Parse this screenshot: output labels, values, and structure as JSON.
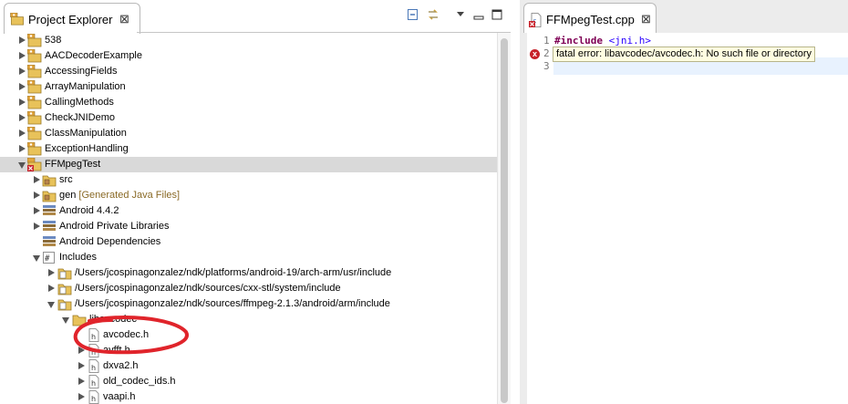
{
  "project_explorer": {
    "title": "Project Explorer",
    "close_glyph": "⊠",
    "toolbar": [
      "collapse-all-icon",
      "link-with-editor-icon",
      "view-menu-icon",
      "minimize-icon",
      "maximize-icon"
    ],
    "items": [
      {
        "label": "538"
      },
      {
        "label": "AACDecoderExample"
      },
      {
        "label": "AccessingFields"
      },
      {
        "label": "ArrayManipulation"
      },
      {
        "label": "CallingMethods"
      },
      {
        "label": "CheckJNIDemo"
      },
      {
        "label": "ClassManipulation"
      },
      {
        "label": "ExceptionHandling"
      },
      {
        "label": "FFMpegTest"
      },
      {
        "label": "src"
      },
      {
        "label": "gen",
        "decoration": "[Generated Java Files]"
      },
      {
        "label": "Android 4.4.2"
      },
      {
        "label": "Android Private Libraries"
      },
      {
        "label": "Android Dependencies"
      },
      {
        "label": "Includes"
      },
      {
        "label": "/Users/jcospinagonzalez/ndk/platforms/android-19/arch-arm/usr/include"
      },
      {
        "label": "/Users/jcospinagonzalez/ndk/sources/cxx-stl/system/include"
      },
      {
        "label": "/Users/jcospinagonzalez/ndk/sources/ffmpeg-2.1.3/android/arm/include"
      },
      {
        "label": "libavcodec"
      },
      {
        "label": "avcodec.h"
      },
      {
        "label": "avfft.h"
      },
      {
        "label": "dxva2.h"
      },
      {
        "label": "old_codec_ids.h"
      },
      {
        "label": "vaapi.h"
      }
    ]
  },
  "editor": {
    "tab_title": "FFMpegTest.cpp",
    "close_glyph": "⊠",
    "line_numbers": [
      "1",
      "2",
      "3"
    ],
    "line1_keyword": "#include",
    "line1_header": "<jni.h>",
    "error_tooltip": "fatal error: libavcodec/avcodec.h: No such file or directory",
    "error_marker": "x"
  },
  "colors": {
    "annotation": "#e0242b",
    "selection": "#d9d9d9",
    "keyword": "#7f0055",
    "string": "#2a00ff",
    "tooltip_bg": "#fffde1"
  }
}
